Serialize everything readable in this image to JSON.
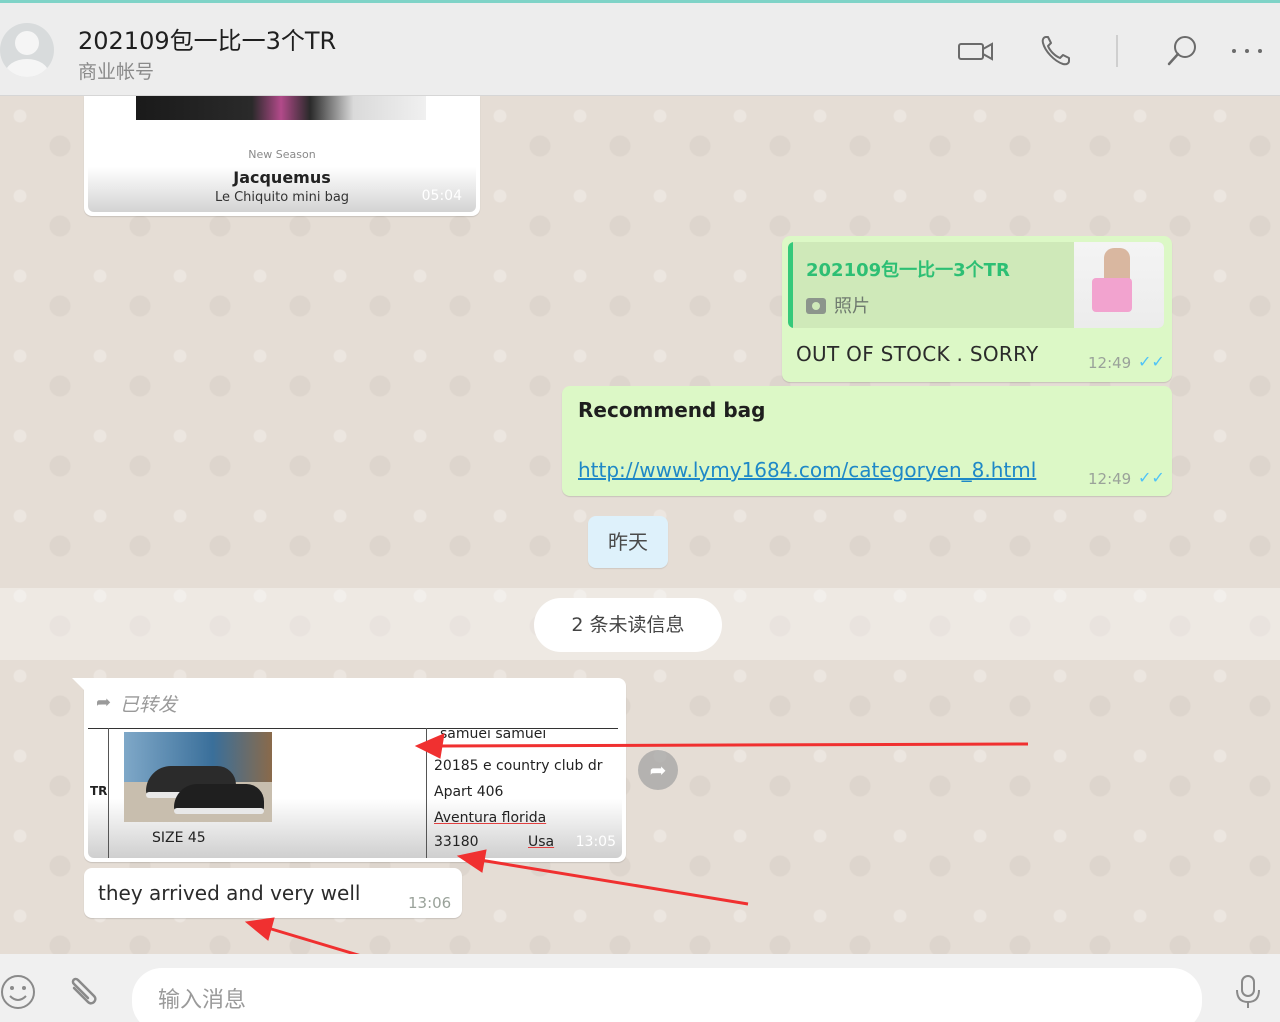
{
  "header": {
    "title": "202109包一比一3个TR",
    "subtitle": "商业帐号"
  },
  "messages": {
    "card": {
      "season": "New Season",
      "brand": "Jacquemus",
      "product": "Le Chiquito mini bag",
      "time": "05:04"
    },
    "reply": {
      "quote_title": "202109包一比一3个TR",
      "quote_sub": "照片",
      "text": "OUT OF STOCK . SORRY",
      "time": "12:49"
    },
    "recommend": {
      "title": "Recommend bag",
      "link": "http://www.lymy1684.com/categoryen_8.html",
      "time": "12:49"
    },
    "date_chip": "昨天",
    "unread": "2 条未读信息",
    "forwarded": {
      "label": "已转发",
      "doc_tr": "TR",
      "size": "SIZE 45",
      "addr_top": "samuel samuel",
      "addr1": "20185 e country club dr",
      "addr2": "Apart 406",
      "addr3": "Aventura florida",
      "zip": "33180",
      "country": "Usa",
      "time": "13:05"
    },
    "arrived": {
      "text": "they arrived and very well",
      "time": "13:06"
    }
  },
  "composer": {
    "placeholder": "输入消息"
  },
  "colors": {
    "outgoing": "#dcf8c6",
    "incoming": "#ffffff",
    "accent": "#2dbf74",
    "link": "#1e88c7",
    "ticks": "#4fc3f7",
    "arrow": "#f03030"
  }
}
